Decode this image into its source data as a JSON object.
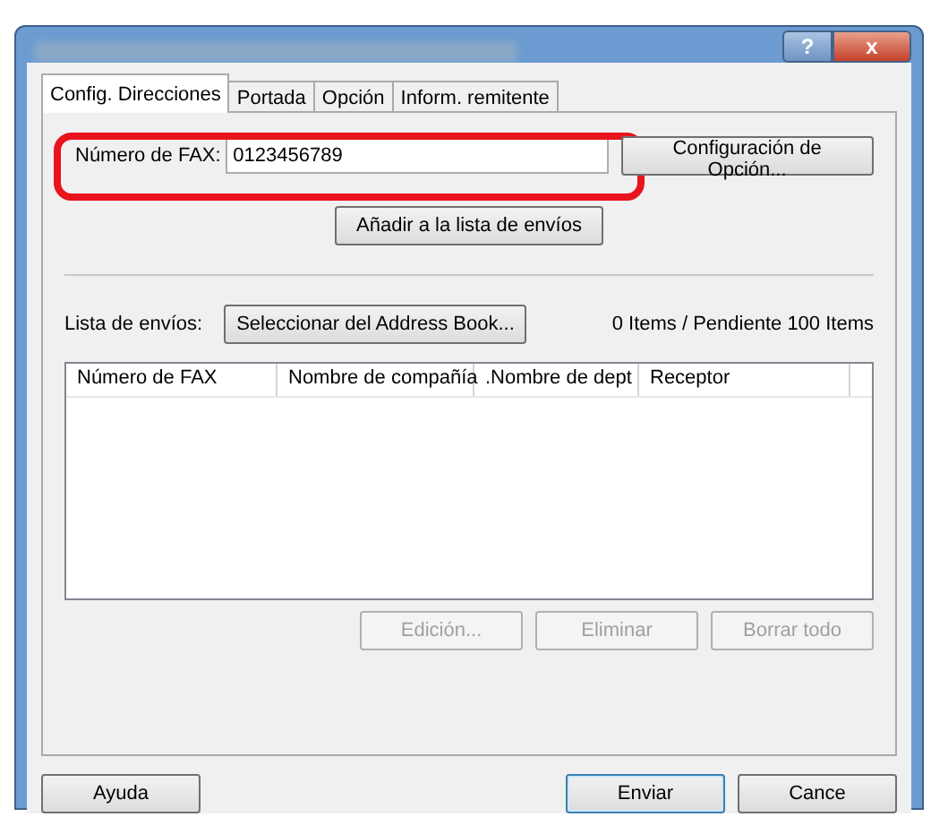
{
  "window": {
    "help_button": "?",
    "close_button": "x"
  },
  "tabs": [
    {
      "label": "Config. Direcciones",
      "selected": true
    },
    {
      "label": "Portada",
      "selected": false
    },
    {
      "label": "Opción",
      "selected": false
    },
    {
      "label": "Inform. remitente",
      "selected": false
    }
  ],
  "fax_field": {
    "label": "Número de FAX:",
    "value": "0123456789",
    "highlighted": true
  },
  "option_settings_button": "Configuración de Opción...",
  "add_button": "Añadir a la lista de envíos",
  "send_list": {
    "label": "Lista de envíos:",
    "address_book_button": "Seleccionar del Address Book...",
    "count": "0 Items / Pendiente 100 Items"
  },
  "table": {
    "columns": [
      "Número de FAX",
      "Nombre de compañía",
      ".Nombre de dept",
      "Receptor"
    ]
  },
  "list_buttons": [
    {
      "label": "Edición...",
      "disabled": true
    },
    {
      "label": "Eliminar",
      "disabled": true
    },
    {
      "label": "Borrar todo",
      "disabled": true
    }
  ],
  "footer_buttons": [
    {
      "label": "Ayuda",
      "default": false
    },
    {
      "label": "Enviar",
      "default": true
    },
    {
      "label": "Cance",
      "default": false
    }
  ]
}
